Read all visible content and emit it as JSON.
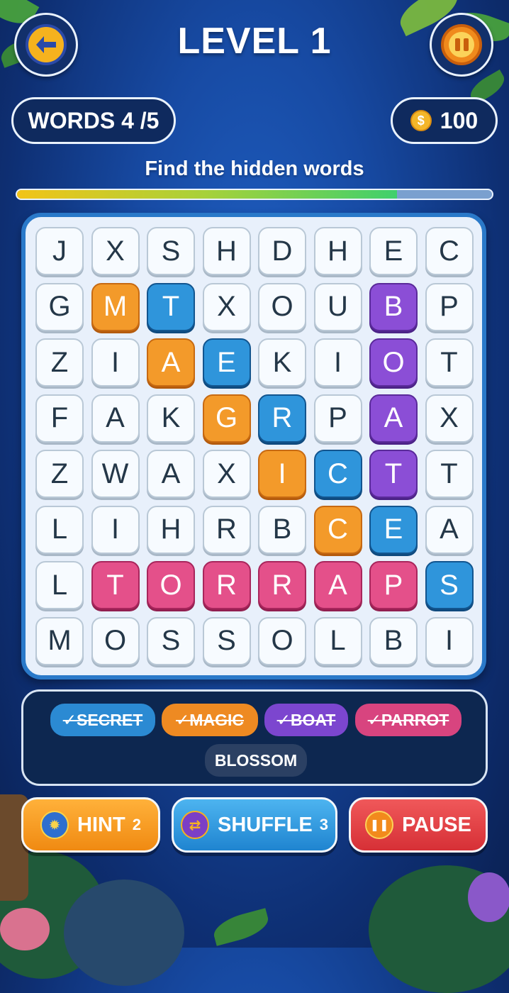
{
  "header": {
    "title": "LEVEL 1",
    "back_icon": "arrow-left-icon",
    "pause_icon": "pause-icon"
  },
  "status": {
    "words_progress": "WORDS 4 /5",
    "coins": "100",
    "coin_icon": "coin-icon"
  },
  "instruction": "Find the hidden words",
  "progress": {
    "fraction": 0.8
  },
  "grid": {
    "rows": [
      [
        "J",
        "X",
        "S",
        "H",
        "D",
        "H",
        "E",
        "C"
      ],
      [
        "G",
        "M",
        "T",
        "X",
        "O",
        "U",
        "B",
        "P"
      ],
      [
        "Z",
        "I",
        "A",
        "E",
        "K",
        "I",
        "O",
        "T"
      ],
      [
        "F",
        "A",
        "K",
        "G",
        "R",
        "P",
        "A",
        "X"
      ],
      [
        "Z",
        "W",
        "A",
        "X",
        "I",
        "C",
        "T",
        "T"
      ],
      [
        "L",
        "I",
        "H",
        "R",
        "B",
        "C",
        "E",
        "A"
      ],
      [
        "L",
        "T",
        "O",
        "R",
        "R",
        "A",
        "P",
        "S"
      ],
      [
        "M",
        "O",
        "S",
        "S",
        "O",
        "L",
        "B",
        "I"
      ]
    ],
    "highlights": [
      [
        null,
        null,
        null,
        null,
        null,
        null,
        null,
        null
      ],
      [
        null,
        "orange",
        "blue",
        null,
        null,
        null,
        "purple",
        null
      ],
      [
        null,
        null,
        "orange",
        "blue",
        null,
        null,
        "purple",
        null
      ],
      [
        null,
        null,
        null,
        "orange",
        "blue",
        null,
        "purple",
        null
      ],
      [
        null,
        null,
        null,
        null,
        "orange",
        "blue",
        "purple",
        null
      ],
      [
        null,
        null,
        null,
        null,
        null,
        "orange",
        "blue",
        null
      ],
      [
        null,
        "pink",
        "pink",
        "pink",
        "pink",
        "pink",
        "pink",
        "blue"
      ],
      [
        null,
        null,
        null,
        null,
        null,
        null,
        null,
        null
      ]
    ],
    "colors": {
      "orange": "#f39a2a",
      "blue": "#2f95db",
      "purple": "#8b4ed6",
      "pink": "#e4508a"
    }
  },
  "words": [
    {
      "label": "✓SECRET",
      "found": true,
      "color": "blue"
    },
    {
      "label": "✓MAGIC",
      "found": true,
      "color": "orange"
    },
    {
      "label": "✓BOAT",
      "found": true,
      "color": "purple"
    },
    {
      "label": "✓PARROT",
      "found": true,
      "color": "pink"
    },
    {
      "label": "BLOSSOM",
      "found": false,
      "color": "none"
    }
  ],
  "actions": {
    "hint": {
      "label": "HINT",
      "count": "2",
      "icon": "lightbulb-icon"
    },
    "shuffle": {
      "label": "SHUFFLE",
      "count": "3",
      "icon": "shuffle-icon"
    },
    "pause": {
      "label": "PAUSE",
      "icon": "pause-icon"
    }
  }
}
